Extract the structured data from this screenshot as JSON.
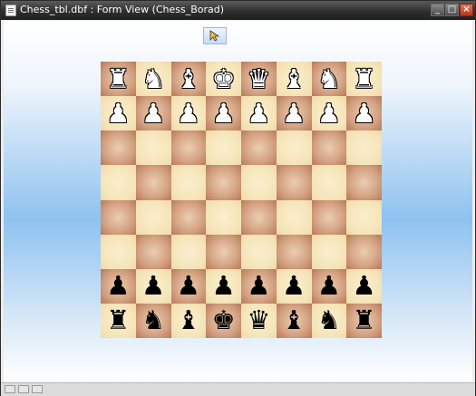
{
  "window": {
    "title": "Chess_tbl.dbf : Form View (Chess_Borad)"
  },
  "titlebar_buttons": {
    "minimize": "_",
    "maximize": "□",
    "close": "×"
  },
  "toolbar": {
    "select_icon": "pointer-arrow-icon"
  },
  "colors": {
    "light_square": "#f5e4b8",
    "dark_square": "#d3a181",
    "client_top": "#ffffff",
    "client_mid": "#8ec2f0"
  },
  "board": {
    "ranks": [
      [
        {
          "p": "♜",
          "c": "white"
        },
        {
          "p": "♞",
          "c": "white"
        },
        {
          "p": "♝",
          "c": "white"
        },
        {
          "p": "♚",
          "c": "white"
        },
        {
          "p": "♛",
          "c": "white"
        },
        {
          "p": "♝",
          "c": "white"
        },
        {
          "p": "♞",
          "c": "white"
        },
        {
          "p": "♜",
          "c": "white"
        }
      ],
      [
        {
          "p": "♟",
          "c": "white"
        },
        {
          "p": "♟",
          "c": "white"
        },
        {
          "p": "♟",
          "c": "white"
        },
        {
          "p": "♟",
          "c": "white"
        },
        {
          "p": "♟",
          "c": "white"
        },
        {
          "p": "♟",
          "c": "white"
        },
        {
          "p": "♟",
          "c": "white"
        },
        {
          "p": "♟",
          "c": "white"
        }
      ],
      [
        {
          "p": "",
          "c": ""
        },
        {
          "p": "",
          "c": ""
        },
        {
          "p": "",
          "c": ""
        },
        {
          "p": "",
          "c": ""
        },
        {
          "p": "",
          "c": ""
        },
        {
          "p": "",
          "c": ""
        },
        {
          "p": "",
          "c": ""
        },
        {
          "p": "",
          "c": ""
        }
      ],
      [
        {
          "p": "",
          "c": ""
        },
        {
          "p": "",
          "c": ""
        },
        {
          "p": "",
          "c": ""
        },
        {
          "p": "",
          "c": ""
        },
        {
          "p": "",
          "c": ""
        },
        {
          "p": "",
          "c": ""
        },
        {
          "p": "",
          "c": ""
        },
        {
          "p": "",
          "c": ""
        }
      ],
      [
        {
          "p": "",
          "c": ""
        },
        {
          "p": "",
          "c": ""
        },
        {
          "p": "",
          "c": ""
        },
        {
          "p": "",
          "c": ""
        },
        {
          "p": "",
          "c": ""
        },
        {
          "p": "",
          "c": ""
        },
        {
          "p": "",
          "c": ""
        },
        {
          "p": "",
          "c": ""
        }
      ],
      [
        {
          "p": "",
          "c": ""
        },
        {
          "p": "",
          "c": ""
        },
        {
          "p": "",
          "c": ""
        },
        {
          "p": "",
          "c": ""
        },
        {
          "p": "",
          "c": ""
        },
        {
          "p": "",
          "c": ""
        },
        {
          "p": "",
          "c": ""
        },
        {
          "p": "",
          "c": ""
        }
      ],
      [
        {
          "p": "♟",
          "c": "black"
        },
        {
          "p": "♟",
          "c": "black"
        },
        {
          "p": "♟",
          "c": "black"
        },
        {
          "p": "♟",
          "c": "black"
        },
        {
          "p": "♟",
          "c": "black"
        },
        {
          "p": "♟",
          "c": "black"
        },
        {
          "p": "♟",
          "c": "black"
        },
        {
          "p": "♟",
          "c": "black"
        }
      ],
      [
        {
          "p": "♜",
          "c": "black"
        },
        {
          "p": "♞",
          "c": "black"
        },
        {
          "p": "♝",
          "c": "black"
        },
        {
          "p": "♚",
          "c": "black"
        },
        {
          "p": "♛",
          "c": "black"
        },
        {
          "p": "♝",
          "c": "black"
        },
        {
          "p": "♞",
          "c": "black"
        },
        {
          "p": "♜",
          "c": "black"
        }
      ]
    ]
  }
}
